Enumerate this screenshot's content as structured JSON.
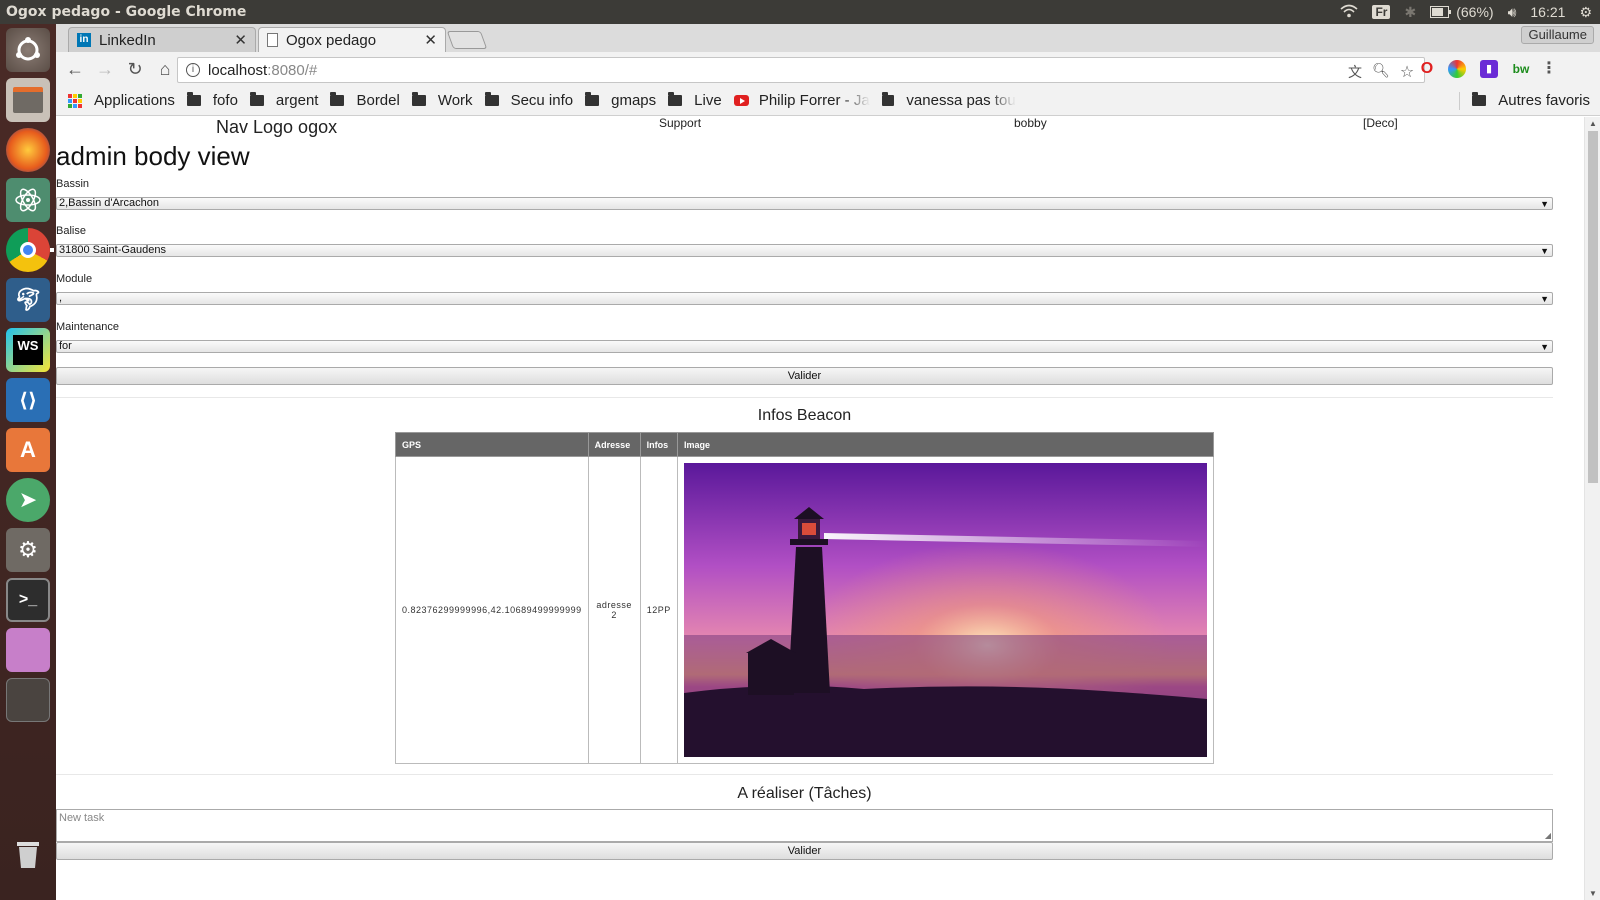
{
  "os": {
    "window_title": "Ogox pedago - Google Chrome",
    "keyboard_layout": "Fr",
    "battery": "(66%)",
    "time": "16:21"
  },
  "browser": {
    "tabs": [
      {
        "label": "LinkedIn"
      },
      {
        "label": "Ogox pedago"
      }
    ],
    "profile": "Guillaume",
    "url_host": "localhost",
    "url_rest": ":8080/#",
    "bookmarks": [
      "Applications",
      "fofo",
      "argent",
      "Bordel",
      "Work",
      "Secu info",
      "gmaps",
      "Live",
      "Philip Forrer - Ja",
      "vanessa pas tou"
    ],
    "other_bookmarks": "Autres favoris"
  },
  "page": {
    "nav": {
      "logo": "Nav Logo ogox",
      "support": "Support",
      "user": "bobby",
      "logout": "[Deco]"
    },
    "title": "admin body view",
    "form": {
      "bassin_label": "Bassin",
      "bassin_value": "2,Bassin d'Arcachon",
      "balise_label": "Balise",
      "balise_value": "31800 Saint-Gaudens",
      "module_label": "Module",
      "module_value": ",",
      "maintenance_label": "Maintenance",
      "maintenance_value": "for",
      "submit": "Valider"
    },
    "beacon": {
      "title": "Infos Beacon",
      "columns": [
        "GPS",
        "Adresse",
        "Infos",
        "Image"
      ],
      "row": {
        "gps": "0.82376299999996,42.10689499999999",
        "adresse": "adresse 2",
        "infos": "12PP"
      }
    },
    "tasks": {
      "title": "A réaliser (Tâches)",
      "placeholder": "New task",
      "submit": "Valider"
    }
  }
}
